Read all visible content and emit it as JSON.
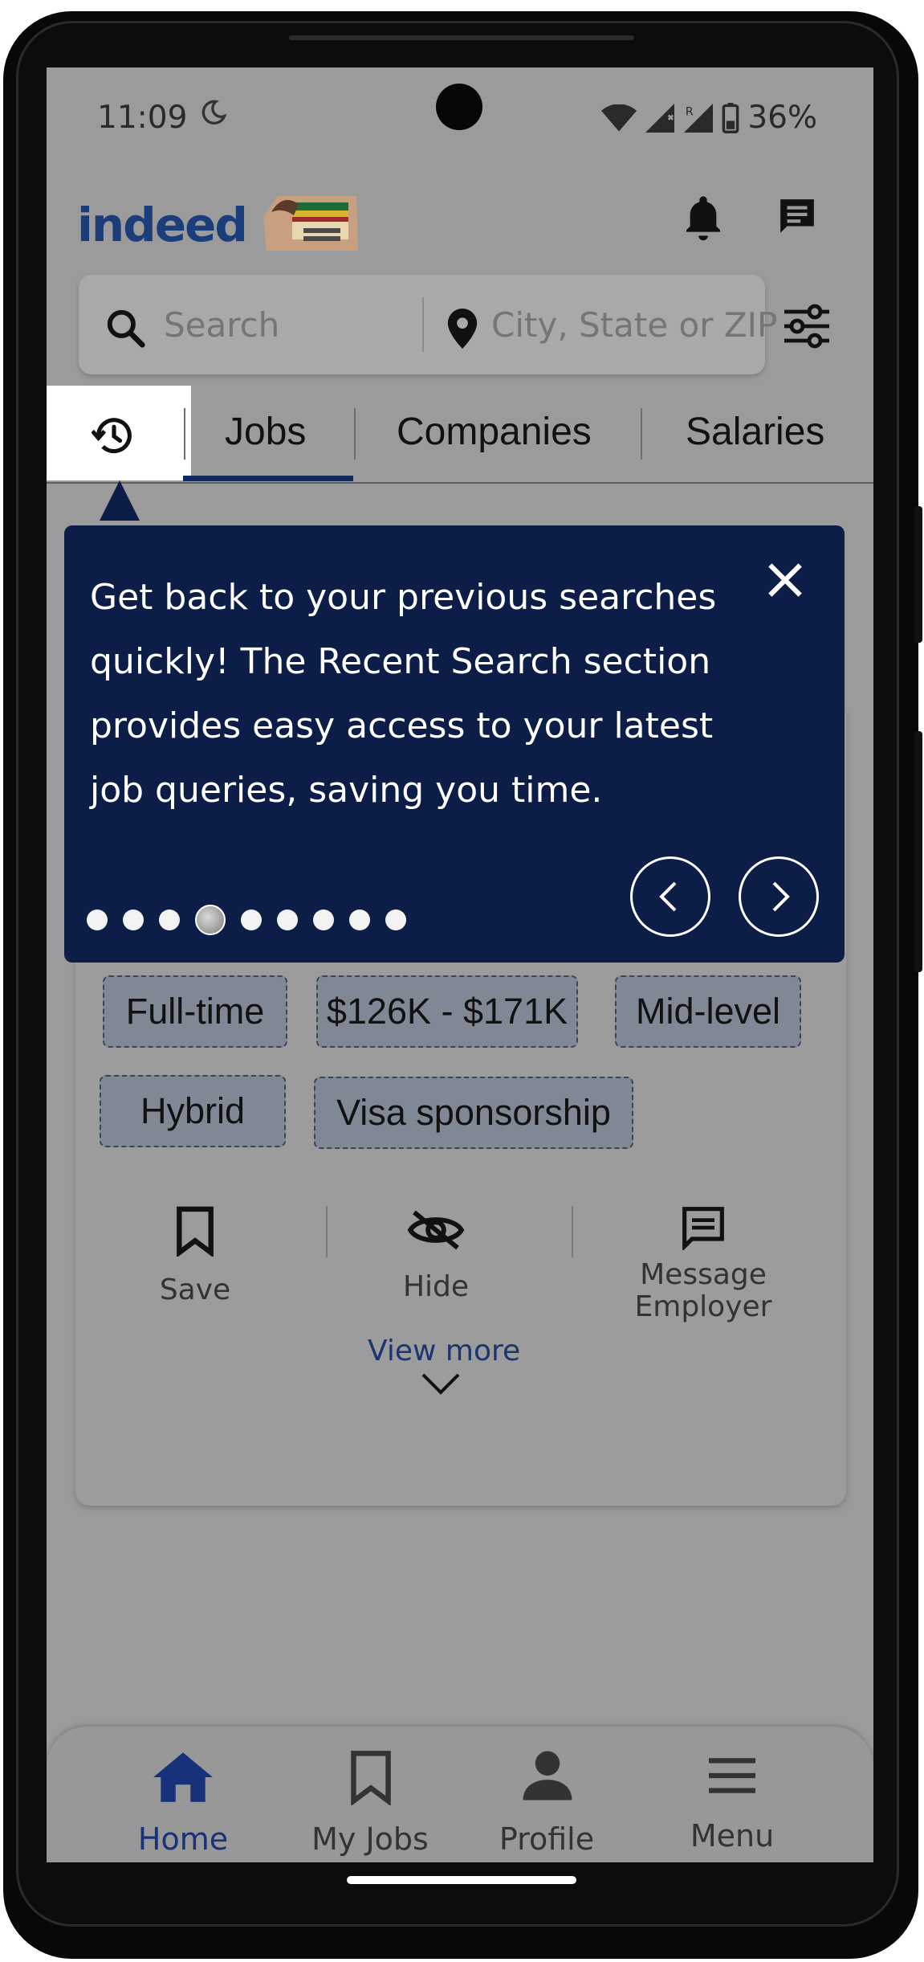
{
  "status_bar": {
    "time": "11:09",
    "battery": "36%",
    "icons": [
      "moon-icon",
      "wifi-icon",
      "signal-icon",
      "signal-roaming-icon",
      "battery-icon"
    ]
  },
  "header": {
    "logo": "indeed",
    "icons": [
      "promo-flag-icon",
      "bell-icon",
      "chat-icon"
    ]
  },
  "search": {
    "what_placeholder": "Search",
    "where_placeholder": "City, State or ZIP",
    "icons": [
      "search-icon",
      "location-pin-icon",
      "filter-sliders-icon"
    ]
  },
  "tabs": {
    "history_icon": "history-icon",
    "items": [
      "Jobs",
      "Companies",
      "Salaries"
    ],
    "active": "Jobs"
  },
  "tooltip": {
    "text": "Get back to your previous searches quickly! The Recent Search section provides easy access to your latest job queries, saving you time.",
    "total_steps": 9,
    "current_step": 4,
    "icons": [
      "close-icon",
      "chevron-left-icon",
      "chevron-right-icon"
    ]
  },
  "job_card": {
    "tags": [
      "Full-time",
      "$126K - $171K",
      "Mid-level",
      "Hybrid",
      "Visa sponsorship"
    ],
    "actions": {
      "save": "Save",
      "hide": "Hide",
      "message": "Message Employer"
    },
    "view_more": "View more"
  },
  "bottom_nav": {
    "home": "Home",
    "my_jobs": "My Jobs",
    "profile": "Profile",
    "menu": "Menu",
    "active": "Home"
  },
  "colors": {
    "brand_navy": "#0c1d47",
    "accent_blue": "#17327a",
    "overlay_gray": "#9b9b9b"
  }
}
